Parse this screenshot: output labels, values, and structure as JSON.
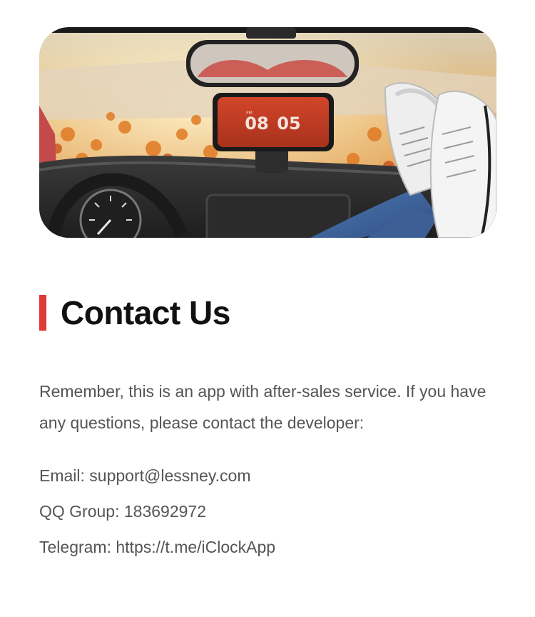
{
  "hero": {
    "image_label": "car-dashboard-phone-clock-photo",
    "clock": {
      "period": "PM",
      "hour": "08",
      "minute": "05"
    }
  },
  "section": {
    "title": "Contact Us"
  },
  "intro": {
    "text": "Remember, this is an app with after-sales service. If you have any questions, please contact the developer:"
  },
  "contacts": {
    "email": "Email: support@lessney.com",
    "qq": "QQ Group: 183692972",
    "telegram": "Telegram: https://t.me/iClockApp"
  },
  "colors": {
    "accent": "#e13838",
    "title": "#111111",
    "body_text": "#555555"
  }
}
